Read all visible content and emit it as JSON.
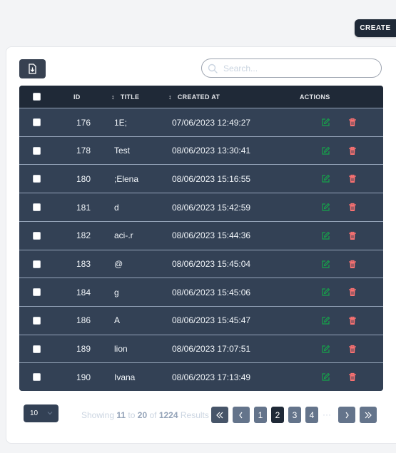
{
  "toolbar": {
    "create_label": "CREATE",
    "export_icon": "download-file-icon"
  },
  "search": {
    "placeholder": "Search..."
  },
  "table": {
    "headers": {
      "id": "ID",
      "title": "TITLE",
      "created_at": "CREATED AT",
      "actions": "ACTIONS"
    },
    "sort_indicator": "↕",
    "rows": [
      {
        "id": "176",
        "title": "1E;",
        "created_at": "07/06/2023 12:49:27"
      },
      {
        "id": "178",
        "title": "Test",
        "created_at": "08/06/2023 13:30:41"
      },
      {
        "id": "180",
        "title": ";Elena",
        "created_at": "08/06/2023 15:16:55"
      },
      {
        "id": "181",
        "title": "d",
        "created_at": "08/06/2023 15:42:59"
      },
      {
        "id": "182",
        "title": "aci-.r",
        "created_at": "08/06/2023 15:44:36"
      },
      {
        "id": "183",
        "title": "@",
        "created_at": "08/06/2023 15:45:04"
      },
      {
        "id": "184",
        "title": "g",
        "created_at": "08/06/2023 15:45:06"
      },
      {
        "id": "186",
        "title": "A",
        "created_at": "08/06/2023 15:45:47"
      },
      {
        "id": "189",
        "title": "lion",
        "created_at": "08/06/2023 17:07:51"
      },
      {
        "id": "190",
        "title": "Ivana",
        "created_at": "08/06/2023 17:13:49"
      }
    ]
  },
  "footer": {
    "page_size": "10",
    "showing_prefix": "Showing",
    "range_start": "11",
    "to_word": "to",
    "range_end": "20",
    "of_word": "of",
    "total": "1224",
    "results_word": "Results",
    "pages": [
      "1",
      "2",
      "3",
      "4"
    ],
    "current_page": "2",
    "ellipsis": "···"
  },
  "colors": {
    "edit": "#16a34a",
    "delete": "#f87171",
    "header_bg": "#1f2937",
    "row_bg": "#334155"
  }
}
